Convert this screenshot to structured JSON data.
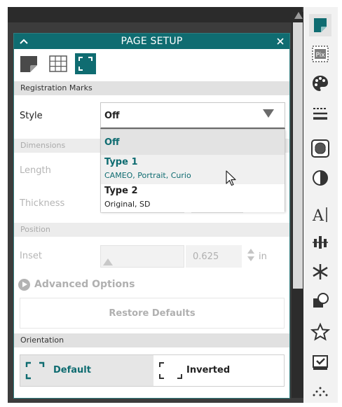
{
  "panel": {
    "title": "PAGE SETUP",
    "collapse_icon": "chevron-up-icon",
    "close_icon": "close-icon",
    "tabs": [
      {
        "icon": "page-icon"
      },
      {
        "icon": "grid-icon"
      },
      {
        "icon": "registration-marks-icon",
        "active": true
      }
    ]
  },
  "registration": {
    "section_label": "Registration Marks",
    "style_label": "Style",
    "style_value": "Off",
    "options": [
      {
        "name": "Off",
        "sub": ""
      },
      {
        "name": "Type 1",
        "sub": "CAMEO, Portrait, Curio"
      },
      {
        "name": "Type 2",
        "sub": "Original, SD"
      }
    ],
    "dimensions_label": "Dimensions",
    "length_label": "Length",
    "thickness_label": "Thickness",
    "position_label": "Position",
    "inset_label": "Inset",
    "inset_value": "0.625",
    "inset_unit": "in",
    "advanced_label": "Advanced Options",
    "restore_label": "Restore Defaults"
  },
  "orientation": {
    "section_label": "Orientation",
    "default_label": "Default",
    "inverted_label": "Inverted",
    "selected": "Default"
  },
  "colors": {
    "accent": "#0f6c71",
    "panel_bg": "#ffffff",
    "dark_bg": "#3c3c3c"
  },
  "right_toolbar": [
    "page-setup-icon",
    "pixscan-icon",
    "fill-palette-icon",
    "line-style-icon",
    "offset-icon",
    "contrast-icon",
    "text-style-icon",
    "align-icon",
    "replicate-icon",
    "modify-icon",
    "favorites-icon",
    "trace-icon",
    "more-icon"
  ]
}
